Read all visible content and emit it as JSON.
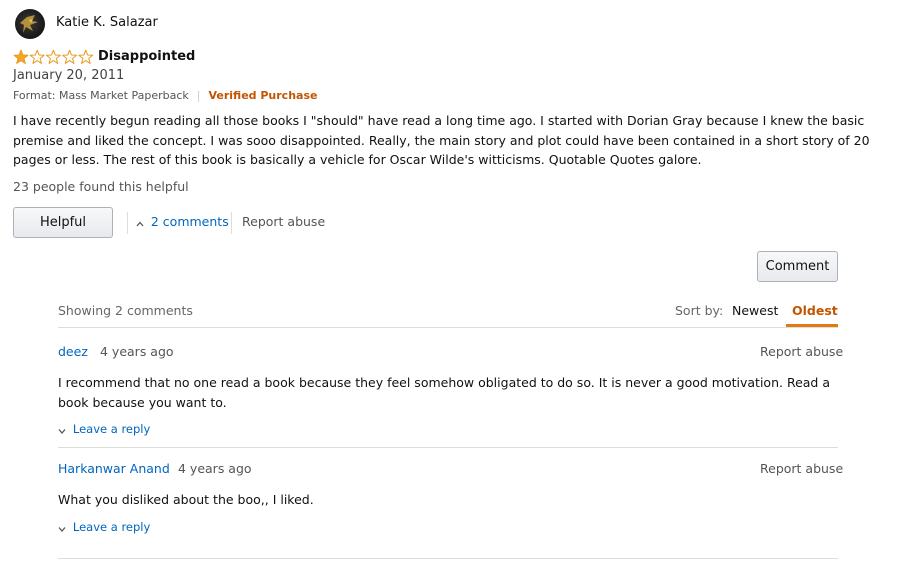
{
  "review": {
    "author": "Katie K. Salazar",
    "rating": 1,
    "max_rating": 5,
    "title": "Disappointed",
    "date": "January 20, 2011",
    "format": "Format: Mass Market Paperback",
    "verified": "Verified Purchase",
    "body": "I have recently begun reading all those books I \"should\" have read a long time ago. I started with Dorian Gray because I knew the basic premise and liked the concept. I was sooo disappointed. Really, the main story and plot could have been contained in a short story of 20 pages or less. The rest of this book is basically a vehicle for Oscar Wilde's witticisms. Quotable Quotes galore.",
    "helpful_count": "23 people found this helpful",
    "helpful_button": "Helpful",
    "comments_toggle": "2 comments",
    "report_abuse": "Report abuse"
  },
  "comments_section": {
    "comment_button": "Comment",
    "showing": "Showing 2 comments",
    "sort_label": "Sort by:",
    "sort_options": [
      "Newest",
      "Oldest"
    ],
    "sort_selected": "Oldest",
    "comments": [
      {
        "author": "deez",
        "time": "4 years ago",
        "report": "Report abuse",
        "text": "I recommend that no one read a book because they feel somehow obligated to do so. It is never a good motivation. Read a book because you want to.",
        "reply": "Leave a reply"
      },
      {
        "author": "Harkanwar Anand",
        "time": "4 years ago",
        "report": "Report abuse",
        "text": "What you disliked about the boo,, I liked.",
        "reply": "Leave a reply"
      }
    ]
  },
  "colors": {
    "star_fill": "#f5a623",
    "star_outline": "#e69b1f",
    "link": "#0066c0",
    "verified": "#c45500",
    "sort_active_underline": "#e47911"
  },
  "icons": {
    "avatar": "profile-avatar",
    "star": "star-icon",
    "chevron_up": "chevron-up-icon",
    "chevron_down": "chevron-down-icon"
  }
}
